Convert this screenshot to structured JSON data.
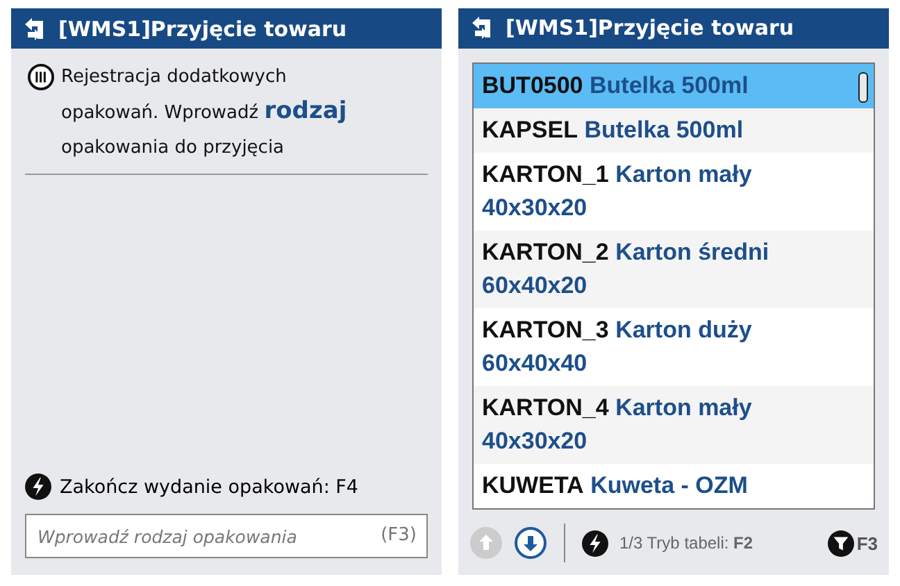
{
  "left_panel": {
    "title": "[WMS1]Przyjęcie towaru",
    "message": "Rejestracja dodatkowych opakowań. Wprowadź **rodzaj** opakowania do przyjęcia",
    "action": "Zakończ wydanie opakowań: F4",
    "input": {
      "placeholder": "Wprowadź rodzaj opakowania",
      "shortcut": "(F3)"
    }
  },
  "right_panel": {
    "title": "[WMS1]Przyjęcie towaru",
    "items": [
      {
        "code": "BUT0500",
        "name": "Butelka 500ml",
        "selected": true
      },
      {
        "code": "KAPSEL",
        "name": "Butelka 500ml",
        "selected": false
      },
      {
        "code": "KARTON_1",
        "name": "Karton mały 40x30x20",
        "selected": false
      },
      {
        "code": "KARTON_2",
        "name": "Karton średni 60x40x20",
        "selected": false
      },
      {
        "code": "KARTON_3",
        "name": "Karton duży 60x40x40",
        "selected": false
      },
      {
        "code": "KARTON_4",
        "name": "Karton mały 40x30x20",
        "selected": false
      },
      {
        "code": "KUWETA",
        "name": "Kuweta - OZM",
        "selected": false
      }
    ],
    "toolbar": {
      "up_disabled": true,
      "down_disabled": false,
      "mode": "1/3 Tryb tabeli: **F2**",
      "filter": "F3"
    }
  }
}
